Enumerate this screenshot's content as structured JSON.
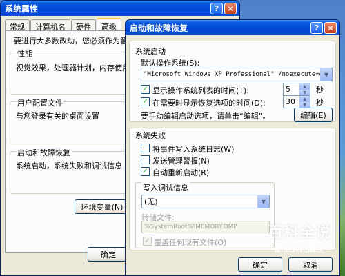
{
  "back_window": {
    "title": "系统属性",
    "help_glyph": "?",
    "close_glyph": "×",
    "tabs": [
      "常规",
      "计算机名",
      "硬件",
      "高级"
    ],
    "active_tab_index": 3,
    "intro_text": "要进行大多数改动，您必须作为管理",
    "performance": {
      "title": "性能",
      "desc": "视觉效果，处理器计划，内存使用，"
    },
    "user_profile": {
      "title": "用户配置文件",
      "desc": "与您登录有关的桌面设置"
    },
    "startup_recovery": {
      "title": "启动和故障恢复",
      "desc": "系统启动，系统失败和调试信息"
    },
    "env_button": "环境变量(N)",
    "ok_button": "确定"
  },
  "front_window": {
    "title": "启动和故障恢复",
    "help_glyph": "?",
    "close_glyph": "×",
    "system_startup": {
      "title": "系统启动",
      "default_os_label": "默认操作系统(S):",
      "default_os_value": "\"Microsoft Windows XP Professional\" /noexecute=optin",
      "show_os_list": {
        "label": "显示操作系统列表的时间(T):",
        "checked": true,
        "value": "5",
        "unit": "秒"
      },
      "show_recovery": {
        "label": "在需要时显示恢复选项的时间(D):",
        "checked": true,
        "value": "30",
        "unit": "秒"
      },
      "edit_hint": "要手动编辑启动选项，请单击“编辑”。",
      "edit_button": "编辑(E)"
    },
    "system_failure": {
      "title": "系统失败",
      "write_event": {
        "label": "将事件写入系统日志(W)",
        "checked": false
      },
      "send_alert": {
        "label": "发送管理警报(N)",
        "checked": false
      },
      "auto_restart": {
        "label": "自动重新启动(R)",
        "checked": true
      },
      "debug_title": "写入调试信息",
      "debug_value": "(无)",
      "dump_file_label": "转储文件:",
      "dump_file_value": "%SystemRoot%\\MEMORY.DMP",
      "overwrite": {
        "label": "覆盖任何现有文件(O)",
        "checked": true,
        "enabled": false
      }
    },
    "ok_button": "确定",
    "cancel_button": "取消"
  },
  "watermark": {
    "title": "百科全说",
    "subtitle": "助你轻松解决"
  },
  "glyphs": {
    "check": "✓",
    "down": "▼",
    "up": "▲"
  }
}
